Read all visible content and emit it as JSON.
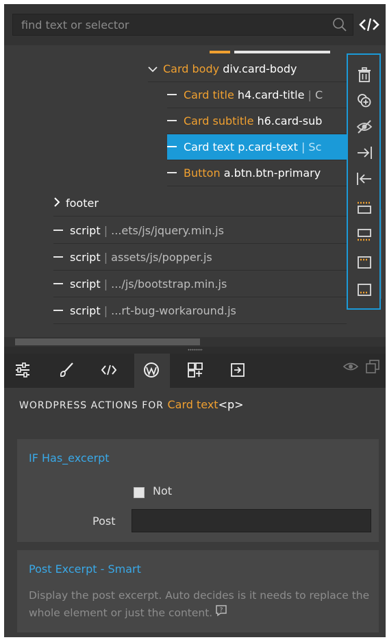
{
  "search": {
    "placeholder": "find text or selector"
  },
  "tree": {
    "rows": [
      {
        "name": "Card body",
        "selector": "div.card-body",
        "extra": ""
      },
      {
        "name": "Card title",
        "selector": "h4.card-title",
        "sep": "|",
        "extra": "C"
      },
      {
        "name": "Card subtitle",
        "selector": "h6.card-sub",
        "extra": ""
      },
      {
        "name": "Card text",
        "selector": "p.card-text",
        "sep": "|",
        "extra": "Sc"
      },
      {
        "name": "Button",
        "selector": "a.btn.btn-primary",
        "extra": ""
      },
      {
        "tag": "footer"
      },
      {
        "tag": "script",
        "sep": "|",
        "extra": "...ets/js/jquery.min.js"
      },
      {
        "tag": "script",
        "sep": "|",
        "extra": "assets/js/popper.js"
      },
      {
        "tag": "script",
        "sep": "|",
        "extra": ".../js/bootstrap.min.js"
      },
      {
        "tag": "script",
        "sep": "|",
        "extra": "...rt-bug-workaround.js"
      }
    ]
  },
  "wordpress": {
    "header_prefix": "WORDPRESS ACTIONS FOR",
    "element_name": "Card text",
    "element_tag": "<p>",
    "condition": {
      "title": "IF Has_excerpt",
      "not_label": "Not",
      "not_checked": false,
      "post_label": "Post",
      "post_value": ""
    },
    "action": {
      "title": "Post Excerpt - Smart",
      "description": "Display the post excerpt. Auto decides is it needs to replace the whole element or just the content."
    }
  },
  "colors": {
    "accent": "#1b9ad8",
    "element_name": "#f0a030",
    "link": "#39a9e8",
    "panel_bg": "#3b3b3b"
  },
  "icons": {
    "toolbar": [
      "trash-icon",
      "duplicate-icon",
      "hide-icon",
      "indent-icon",
      "outdent-icon",
      "insert-before-icon",
      "insert-after-icon",
      "insert-top-icon",
      "insert-bottom-icon"
    ],
    "tabs": [
      "settings-sliders-icon",
      "brush-icon",
      "code-icon",
      "wordpress-icon",
      "components-icon",
      "export-icon"
    ]
  }
}
